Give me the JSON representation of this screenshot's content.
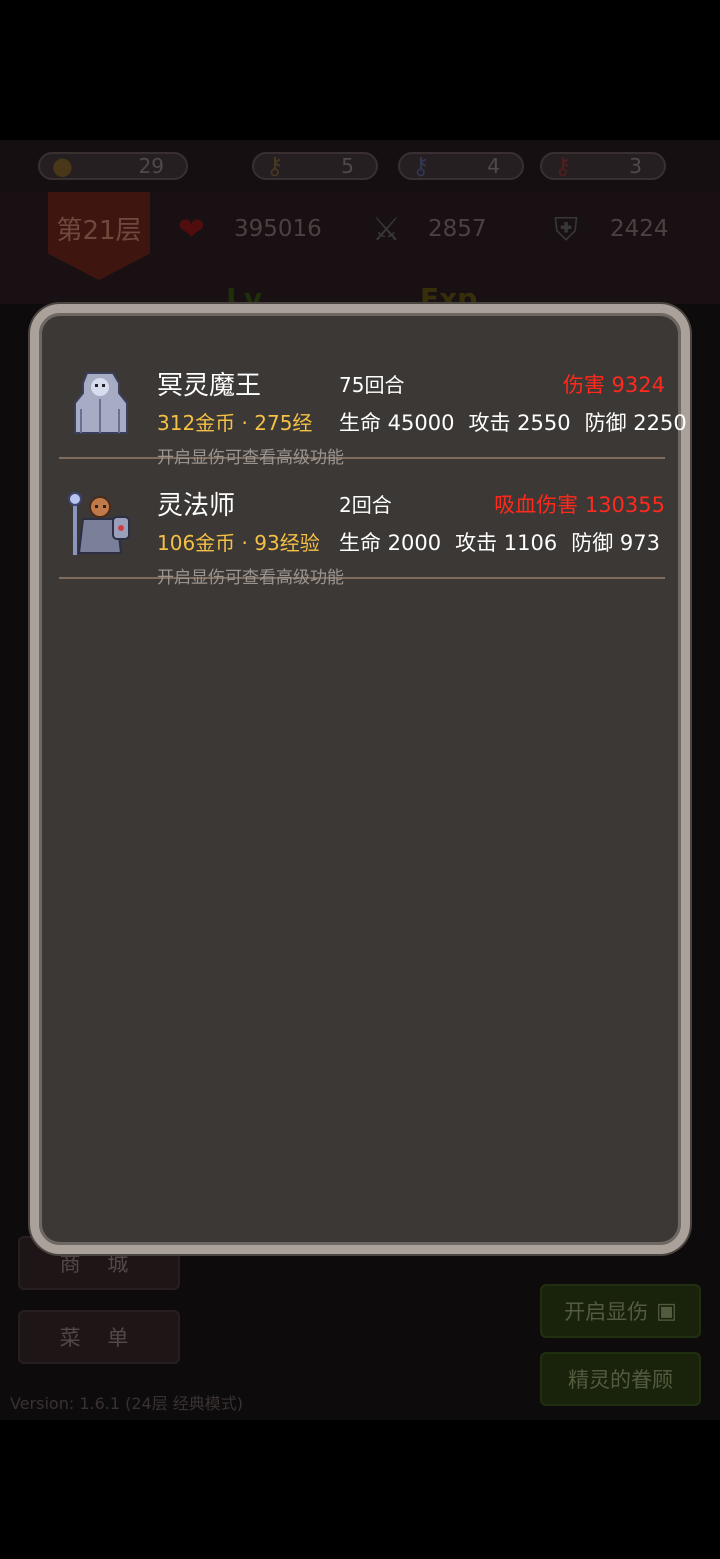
{
  "resources": {
    "coins": "29",
    "yellow_keys": "5",
    "blue_keys": "4",
    "red_keys": "3"
  },
  "floor": "第21层",
  "hero": {
    "hp": "395016",
    "attack": "2857",
    "defense": "2424"
  },
  "level_labels": {
    "lv": "Lv",
    "exp": "Exp"
  },
  "menu": {
    "shop": "商 城",
    "menu": "菜 单",
    "show_damage": "开启显伤",
    "spirit": "精灵的眷顾"
  },
  "version": "Version: 1.6.1 (24层 经典模式)",
  "monsters": [
    {
      "name": "冥灵魔王",
      "rounds": "75回合",
      "damage": "伤害 9324",
      "reward": "312金币 · 275经",
      "hp": "生命 45000",
      "atk": "攻击 2550",
      "def": "防御 2250",
      "hint": "开启显伤可查看高级功能",
      "portrait": "ghost-king-icon"
    },
    {
      "name": "灵法师",
      "rounds": "2回合",
      "damage": "吸血伤害 130355",
      "reward": "106金币 · 93经验",
      "hp": "生命 2000",
      "atk": "攻击 1106",
      "def": "防御 973",
      "hint": "开启显伤可查看高级功能",
      "portrait": "spirit-mage-icon"
    }
  ],
  "colors": {
    "damage": "#ff2a1c",
    "reward": "#f4c045",
    "dialog_bg": "#3b3836",
    "dialog_border": "#aaa19a"
  }
}
